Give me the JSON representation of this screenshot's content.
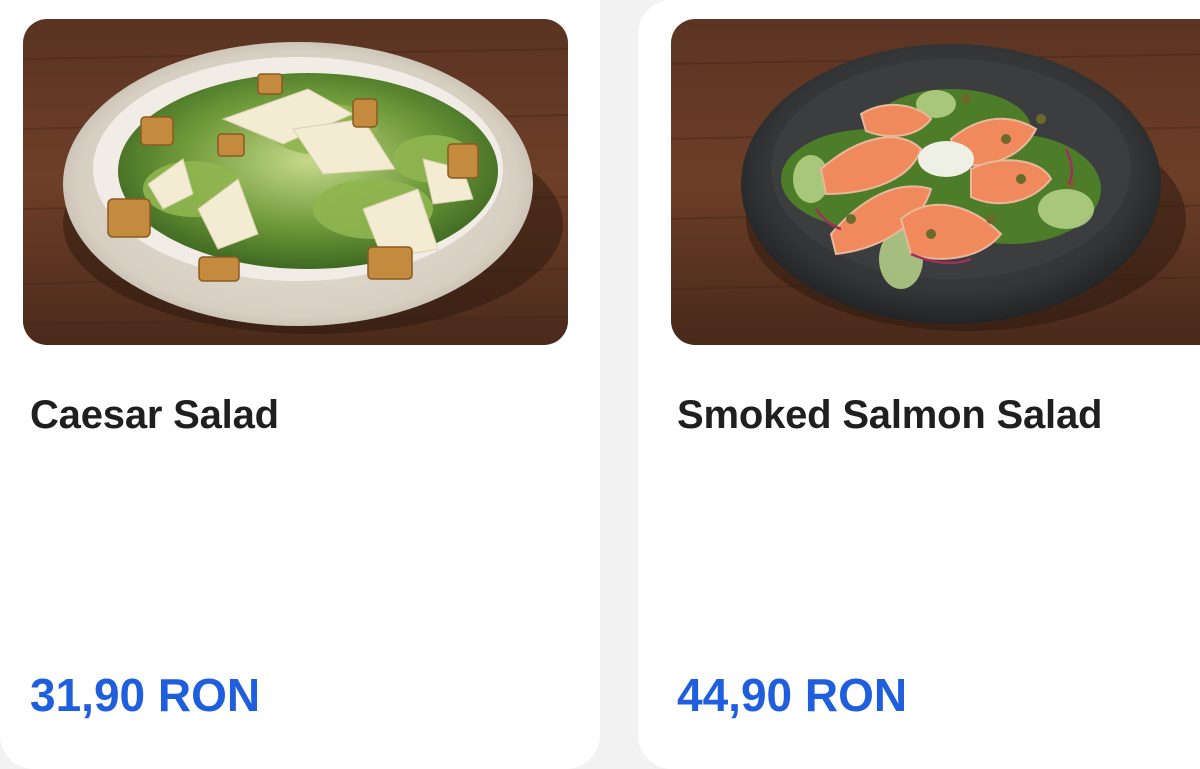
{
  "products": [
    {
      "name": "Caesar Salad",
      "price": "31,90 RON",
      "image_icon": "caesar-salad-photo"
    },
    {
      "name": "Smoked Salmon Salad",
      "price": "44,90 RON",
      "image_icon": "smoked-salmon-salad-photo"
    }
  ],
  "colors": {
    "price": "#1f5fde",
    "title": "#1f1f1f",
    "card": "#ffffff",
    "background": "#f2f2f3"
  }
}
